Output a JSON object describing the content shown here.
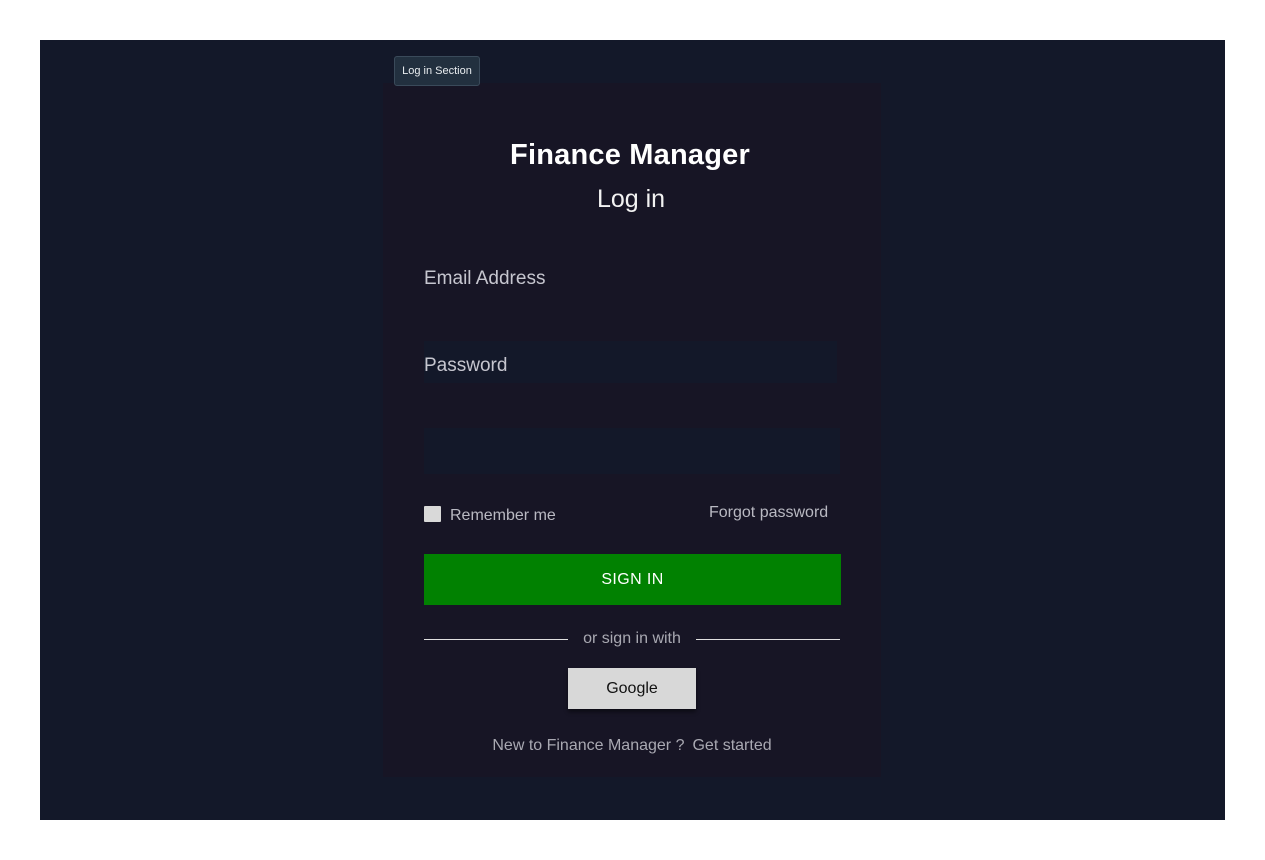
{
  "section_tag": "Log in Section",
  "header": {
    "app_title": "Finance Manager",
    "subtitle": "Log in"
  },
  "form": {
    "email_label": "Email Address",
    "email_value": "",
    "password_label": "Password",
    "password_value": "",
    "remember_label": "Remember me",
    "remember_checked": false,
    "forgot_label": "Forgot password",
    "sign_in_label": "SIGN IN",
    "divider_text": "or sign in with",
    "google_label": "Google"
  },
  "footer": {
    "prompt": "New to Finance Manager ?",
    "link": "Get started"
  },
  "colors": {
    "background": "#131829",
    "card": "#171525",
    "primary_button": "#018101",
    "google_button": "#d8d8d8"
  }
}
